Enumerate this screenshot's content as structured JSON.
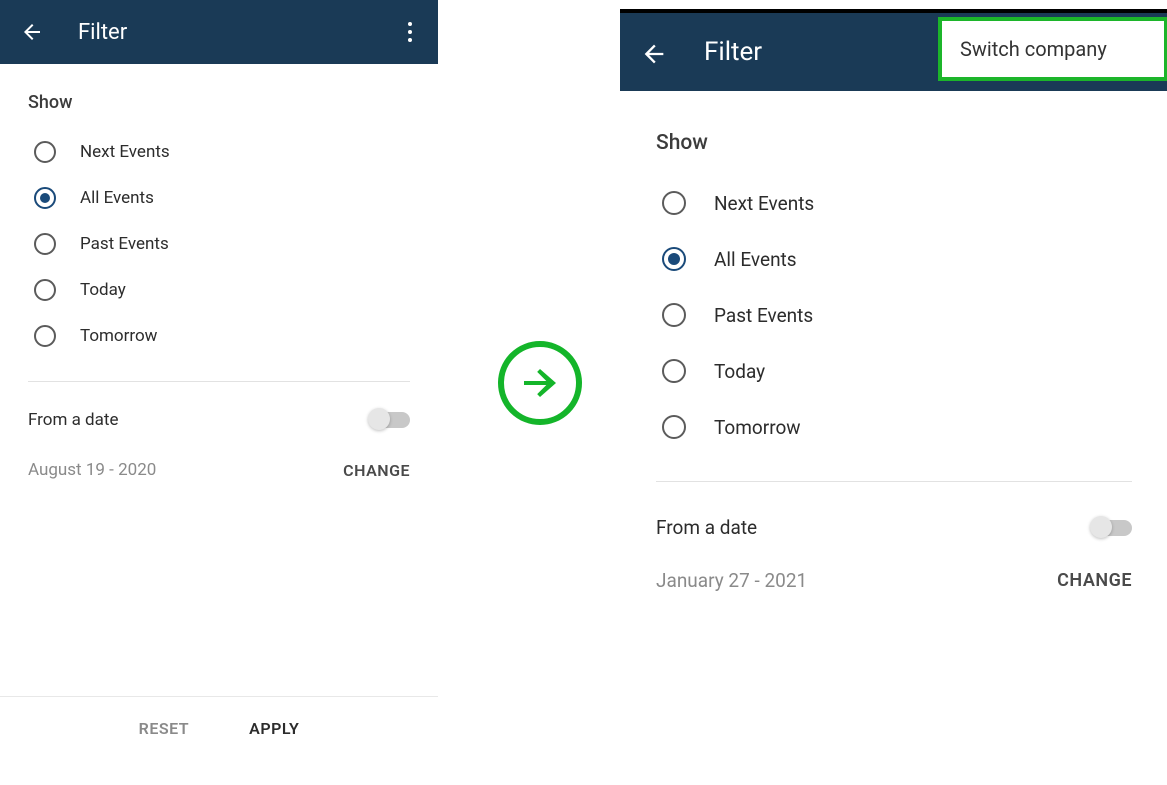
{
  "left": {
    "appbar": {
      "title": "Filter"
    },
    "section_show": "Show",
    "radios": [
      {
        "label": "Next Events",
        "selected": false
      },
      {
        "label": "All Events",
        "selected": true
      },
      {
        "label": "Past Events",
        "selected": false
      },
      {
        "label": "Today",
        "selected": false
      },
      {
        "label": "Tomorrow",
        "selected": false
      }
    ],
    "from_date_label": "From a date",
    "from_date_on": false,
    "date_text": "August 19 - 2020",
    "change_label": "CHANGE",
    "reset_label": "RESET",
    "apply_label": "APPLY"
  },
  "right": {
    "appbar": {
      "title": "Filter"
    },
    "menu_item": "Switch company",
    "section_show": "Show",
    "radios": [
      {
        "label": "Next Events",
        "selected": false
      },
      {
        "label": "All Events",
        "selected": true
      },
      {
        "label": "Past Events",
        "selected": false
      },
      {
        "label": "Today",
        "selected": false
      },
      {
        "label": "Tomorrow",
        "selected": false
      }
    ],
    "from_date_label": "From a date",
    "from_date_on": false,
    "date_text": "January 27 - 2021",
    "change_label": "CHANGE"
  }
}
